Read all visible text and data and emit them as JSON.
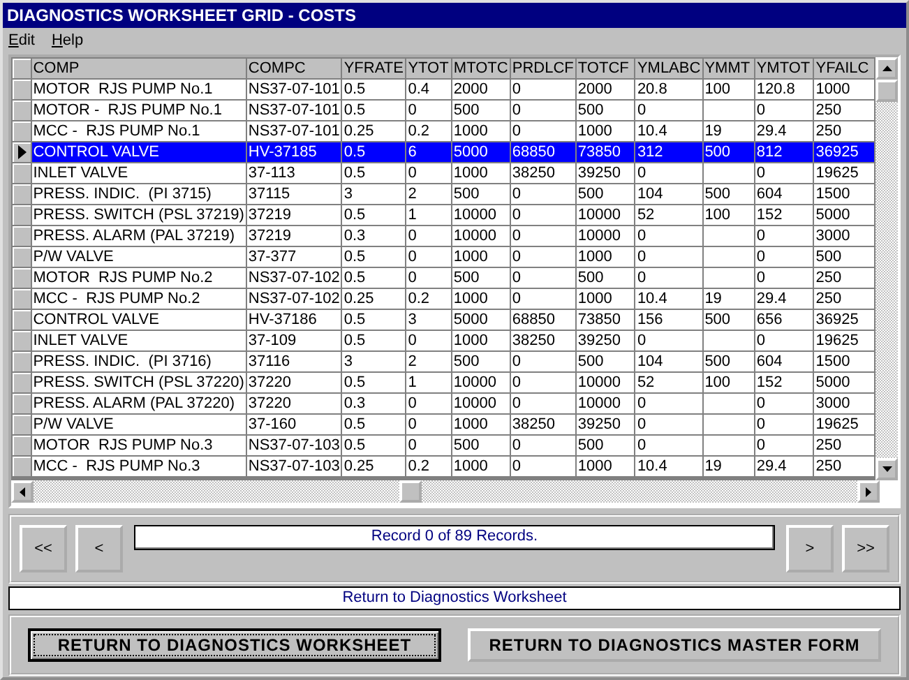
{
  "window": {
    "title": "DIAGNOSTICS WORKSHEET GRID - COSTS"
  },
  "menu": [
    {
      "label": "Edit"
    },
    {
      "label": "Help"
    }
  ],
  "table": {
    "columns": [
      "COMP",
      "COMPC",
      "YFRATE",
      "YTOT",
      "MTOTC",
      "PRDLCF",
      "TOTCF",
      "YMLABC",
      "YMMT",
      "YMTOT",
      "YFAILC"
    ],
    "rows": [
      {
        "selected": false,
        "cells": [
          "MOTOR  RJS PUMP No.1",
          "NS37-07-101",
          "0.5",
          "0.4",
          "2000",
          "0",
          "2000",
          "20.8",
          "100",
          "120.8",
          "1000"
        ]
      },
      {
        "selected": false,
        "cells": [
          "MOTOR -  RJS PUMP No.1",
          "NS37-07-101",
          "0.5",
          "0",
          "500",
          "0",
          "500",
          "0",
          "",
          "0",
          "250"
        ]
      },
      {
        "selected": false,
        "cells": [
          "MCC -  RJS PUMP No.1",
          "NS37-07-101",
          "0.25",
          "0.2",
          "1000",
          "0",
          "1000",
          "10.4",
          "19",
          "29.4",
          "250"
        ]
      },
      {
        "selected": true,
        "cells": [
          "CONTROL VALVE",
          "HV-37185",
          "0.5",
          "6",
          "5000",
          "68850",
          "73850",
          "312",
          "500",
          "812",
          "36925"
        ]
      },
      {
        "selected": false,
        "cells": [
          "INLET VALVE",
          "37-113",
          "0.5",
          "0",
          "1000",
          "38250",
          "39250",
          "0",
          "",
          "0",
          "19625"
        ]
      },
      {
        "selected": false,
        "cells": [
          "PRESS. INDIC.  (PI 3715)",
          "37115",
          "3",
          "2",
          "500",
          "0",
          "500",
          "104",
          "500",
          "604",
          "1500"
        ]
      },
      {
        "selected": false,
        "cells": [
          "PRESS. SWITCH (PSL 37219)",
          "37219",
          "0.5",
          "1",
          "10000",
          "0",
          "10000",
          "52",
          "100",
          "152",
          "5000"
        ]
      },
      {
        "selected": false,
        "cells": [
          "PRESS. ALARM (PAL 37219)",
          "37219",
          "0.3",
          "0",
          "10000",
          "0",
          "10000",
          "0",
          "",
          "0",
          "3000"
        ]
      },
      {
        "selected": false,
        "cells": [
          "P/W VALVE",
          "37-377",
          "0.5",
          "0",
          "1000",
          "0",
          "1000",
          "0",
          "",
          "0",
          "500"
        ]
      },
      {
        "selected": false,
        "cells": [
          "MOTOR  RJS PUMP No.2",
          "NS37-07-102",
          "0.5",
          "0",
          "500",
          "0",
          "500",
          "0",
          "",
          "0",
          "250"
        ]
      },
      {
        "selected": false,
        "cells": [
          "MCC -  RJS PUMP No.2",
          "NS37-07-102",
          "0.25",
          "0.2",
          "1000",
          "0",
          "1000",
          "10.4",
          "19",
          "29.4",
          "250"
        ]
      },
      {
        "selected": false,
        "cells": [
          "CONTROL VALVE",
          "HV-37186",
          "0.5",
          "3",
          "5000",
          "68850",
          "73850",
          "156",
          "500",
          "656",
          "36925"
        ]
      },
      {
        "selected": false,
        "cells": [
          "INLET VALVE",
          "37-109",
          "0.5",
          "0",
          "1000",
          "38250",
          "39250",
          "0",
          "",
          "0",
          "19625"
        ]
      },
      {
        "selected": false,
        "cells": [
          "PRESS. INDIC.  (PI 3716)",
          "37116",
          "3",
          "2",
          "500",
          "0",
          "500",
          "104",
          "500",
          "604",
          "1500"
        ]
      },
      {
        "selected": false,
        "cells": [
          "PRESS. SWITCH (PSL 37220)",
          "37220",
          "0.5",
          "1",
          "10000",
          "0",
          "10000",
          "52",
          "100",
          "152",
          "5000"
        ]
      },
      {
        "selected": false,
        "cells": [
          "PRESS. ALARM (PAL 37220)",
          "37220",
          "0.3",
          "0",
          "10000",
          "0",
          "10000",
          "0",
          "",
          "0",
          "3000"
        ]
      },
      {
        "selected": false,
        "cells": [
          "P/W VALVE",
          "37-160",
          "0.5",
          "0",
          "1000",
          "38250",
          "39250",
          "0",
          "",
          "0",
          "19625"
        ]
      },
      {
        "selected": false,
        "cells": [
          "MOTOR  RJS PUMP No.3",
          "NS37-07-103",
          "0.5",
          "0",
          "500",
          "0",
          "500",
          "0",
          "",
          "0",
          "250"
        ]
      },
      {
        "selected": false,
        "cells": [
          "MCC -  RJS PUMP No.3",
          "NS37-07-103",
          "0.25",
          "0.2",
          "1000",
          "0",
          "1000",
          "10.4",
          "19",
          "29.4",
          "250"
        ]
      }
    ]
  },
  "navigator": {
    "first": "<<",
    "prev": "<",
    "record": "Record 0 of 89 Records.",
    "next": ">",
    "last": ">>"
  },
  "status_bar": "Return to Diagnostics Worksheet",
  "buttons": [
    {
      "label": "RETURN TO DIAGNOSTICS WORKSHEET",
      "focused": true
    },
    {
      "label": "RETURN TO DIAGNOSTICS MASTER FORM",
      "focused": false
    }
  ]
}
